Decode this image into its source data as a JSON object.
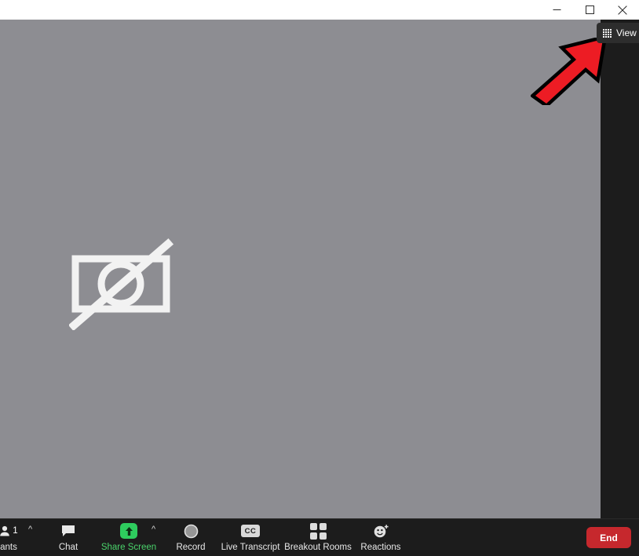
{
  "window": {
    "controls": [
      {
        "name": "minimize",
        "glyph": "minimize-icon"
      },
      {
        "name": "maximize",
        "glyph": "maximize-icon"
      },
      {
        "name": "close",
        "glyph": "close-icon"
      }
    ]
  },
  "stage": {
    "video_state": "camera-off",
    "video_icon": "camera-off-icon",
    "background_color": "#8d8d92"
  },
  "view_button": {
    "label": "View",
    "icon": "grid-view-icon",
    "background_color": "#2d2d2d"
  },
  "annotation": {
    "type": "arrow",
    "direction": "up-right",
    "fill_color": "#ed1c24",
    "stroke_color": "#000000",
    "points_to": "View"
  },
  "toolbar": {
    "background_color": "#1c1c1c",
    "items": [
      {
        "id": "participants",
        "label": "ants",
        "full_label": "Participants",
        "icon": "participants-icon",
        "badge": "1",
        "has_caret": true,
        "accent": false
      },
      {
        "id": "chat",
        "label": "Chat",
        "icon": "chat-bubble-icon",
        "has_caret": false,
        "accent": false
      },
      {
        "id": "share-screen",
        "label": "Share Screen",
        "icon": "share-screen-icon",
        "has_caret": true,
        "accent": true,
        "accent_color": "#2ecc5e"
      },
      {
        "id": "record",
        "label": "Record",
        "icon": "record-circle-icon",
        "has_caret": false,
        "accent": false
      },
      {
        "id": "live-transcript",
        "label": "Live Transcript",
        "icon": "closed-caption-icon",
        "icon_text": "CC",
        "has_caret": false,
        "accent": false
      },
      {
        "id": "breakout-rooms",
        "label": "Breakout Rooms",
        "icon": "breakout-rooms-grid-icon",
        "has_caret": false,
        "accent": false
      },
      {
        "id": "reactions",
        "label": "Reactions",
        "icon": "reactions-smiley-plus-icon",
        "has_caret": false,
        "accent": false
      }
    ],
    "end_button": {
      "label": "End",
      "color": "#c6282d"
    }
  }
}
